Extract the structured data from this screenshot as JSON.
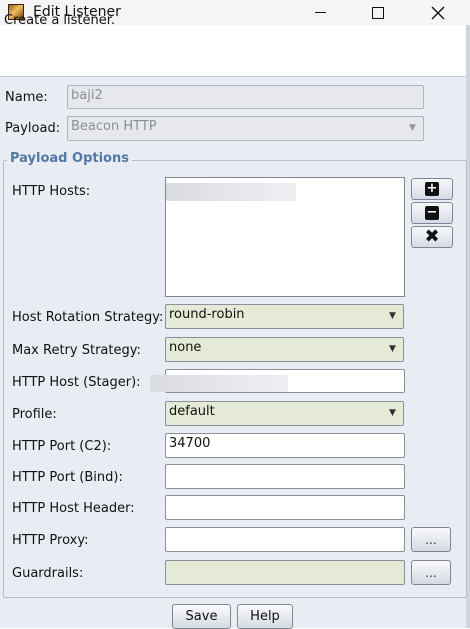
{
  "window": {
    "title": "Edit Listener"
  },
  "header": {
    "text": "Create a listener."
  },
  "form": {
    "name_label": "Name:",
    "name_value": "baji2",
    "payload_label": "Payload:",
    "payload_value": "Beacon HTTP"
  },
  "payload_options": {
    "legend": "Payload Options",
    "http_hosts_label": "HTTP Hosts:",
    "host_rotation_label": "Host Rotation Strategy:",
    "host_rotation_value": "round-robin",
    "max_retry_label": "Max Retry Strategy:",
    "max_retry_value": "none",
    "host_stager_label": "HTTP Host (Stager):",
    "profile_label": "Profile:",
    "profile_value": "default",
    "port_c2_label": "HTTP Port (C2):",
    "port_c2_value": "34700",
    "port_bind_label": "HTTP Port (Bind):",
    "port_bind_value": "",
    "host_header_label": "HTTP Host Header:",
    "host_header_value": "",
    "proxy_label": "HTTP Proxy:",
    "proxy_value": "",
    "guardrails_label": "Guardrails:",
    "guardrails_value": "",
    "browse_label": "..."
  },
  "icons": {
    "add": "plus-icon",
    "remove": "minus-icon",
    "clear": "x-icon"
  },
  "buttons": {
    "save": "Save",
    "help": "Help"
  },
  "colors": {
    "background": "#e8ecf3",
    "legend": "#5577a3",
    "combo_bg": "#e5ead6"
  }
}
